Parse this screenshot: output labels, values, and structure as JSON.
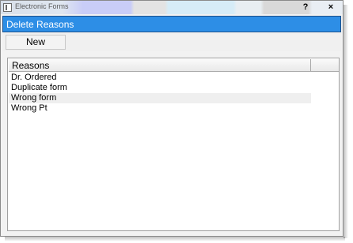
{
  "window": {
    "title": "Electronic Forms",
    "help_label": "?",
    "close_label": "×"
  },
  "header": {
    "title": "Delete Reasons"
  },
  "toolbar": {
    "new_label": "New"
  },
  "grid": {
    "column_header": "Reasons",
    "rows": [
      "Dr. Ordered",
      "Duplicate form",
      "Wrong form",
      "Wrong Pt"
    ],
    "highlighted_row": 2
  },
  "colors": {
    "header_band": "#2d8ee6",
    "header_text": "#ffffff"
  },
  "icons": {
    "app": "form-window-icon"
  }
}
